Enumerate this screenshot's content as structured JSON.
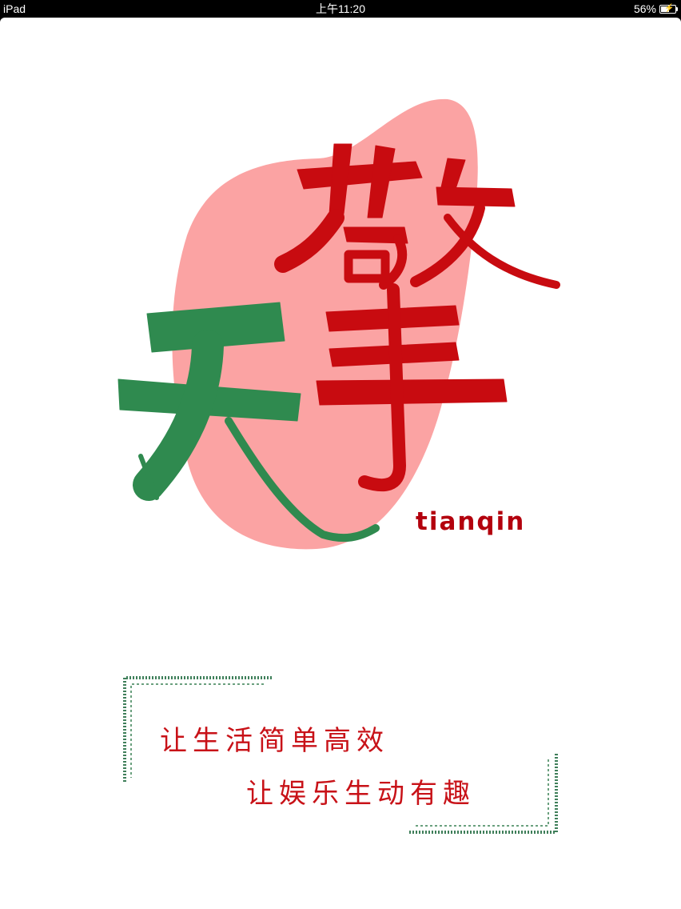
{
  "status_bar": {
    "device": "iPad",
    "time": "上午11:20",
    "battery_percent_label": "56%",
    "battery_level": 0.56
  },
  "splash": {
    "brand_chinese": [
      "天",
      "擎"
    ],
    "brand_latin": "tianqin",
    "slogans": [
      "让生活简单高效",
      "让娱乐生动有趣"
    ]
  },
  "colors": {
    "background": "#ffffff",
    "blob_pink": "#fba3a3",
    "brand_red": "#c80b10",
    "brand_green": "#2f8a4f",
    "frame_green": "#3f7f5a",
    "slogan_red": "#c81218"
  }
}
